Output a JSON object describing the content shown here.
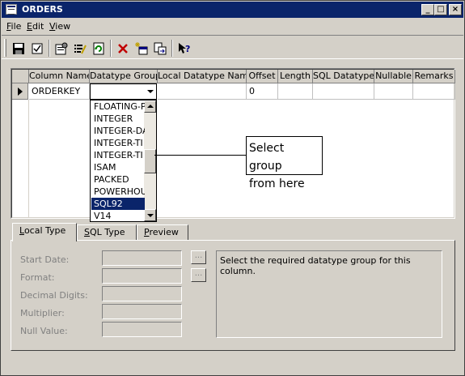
{
  "window": {
    "title": "ORDERS",
    "minimize": "_",
    "maximize": "□",
    "close": "×"
  },
  "menu": [
    "File",
    "Edit",
    "View"
  ],
  "toolbar": {
    "icons": [
      "save-icon",
      "checklist-icon",
      "properties-icon",
      "edit-list-icon",
      "refresh-icon",
      "delete-icon",
      "add-table-icon",
      "export-icon",
      "help-icon"
    ]
  },
  "grid": {
    "columns": [
      {
        "label": "Column Name"
      },
      {
        "label": "Datatype Group"
      },
      {
        "label": "Local Datatype Name"
      },
      {
        "label": "Offset"
      },
      {
        "label": "Length"
      },
      {
        "label": "SQL Datatype"
      },
      {
        "label": "Nullable"
      },
      {
        "label": "Remarks"
      }
    ],
    "row": {
      "column_name": "ORDERKEY",
      "datatype_group": "",
      "local_datatype_name": "",
      "offset": "0",
      "length": "",
      "sql_datatype": "",
      "nullable": "",
      "remarks": ""
    }
  },
  "dropdown": {
    "items": [
      "FLOATING-P",
      "INTEGER",
      "INTEGER-DA",
      "INTEGER-TI",
      "INTEGER-TI",
      "ISAM",
      "PACKED",
      "POWERHOU",
      "SQL92",
      "V14"
    ],
    "selected_index": 8
  },
  "callout": {
    "line1": "Select group",
    "line2": "from here"
  },
  "tabs": [
    "Local Type",
    "SQL Type",
    "Preview"
  ],
  "form": {
    "start_date_label": "Start Date:",
    "format_label": "Format:",
    "decimal_digits_label": "Decimal Digits:",
    "multiplier_label": "Multiplier:",
    "null_value_label": "Null Value:",
    "ellipsis": "...",
    "description": "Select the required datatype group for this column."
  }
}
